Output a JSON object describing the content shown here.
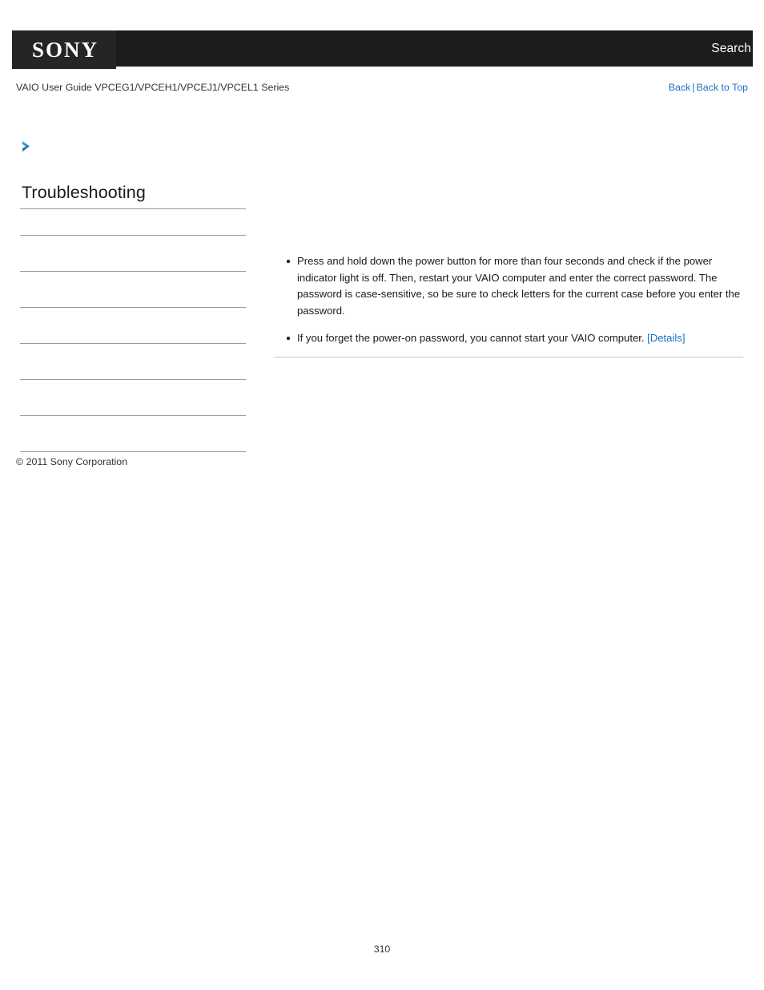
{
  "header": {
    "logo_text": "SONY",
    "search_label": "Search",
    "logo_bg": "#252525",
    "bar_bg": "#1c1c1c"
  },
  "subheader": {
    "guide_title": "VAIO User Guide VPCEG1/VPCEH1/VPCEJ1/VPCEL1 Series",
    "back_label": "Back",
    "separator": "|",
    "back_to_top_label": "Back to Top",
    "link_color": "#1d6fc4"
  },
  "breadcrumb": {
    "icon": "chevron-right-icon",
    "icon_color": "#1d7fc9"
  },
  "left_column": {
    "heading": "Troubleshooting",
    "menu_items": [
      {
        "label": ""
      },
      {
        "label": ""
      },
      {
        "label": ""
      },
      {
        "label": ""
      },
      {
        "label": ""
      },
      {
        "label": ""
      },
      {
        "label": ""
      }
    ],
    "copyright": "© 2011 Sony Corporation"
  },
  "main": {
    "bullets": [
      {
        "text": "Press and hold down the power button for more than four seconds and check if the power indicator light is off. Then, restart your VAIO computer and enter the correct password. The password is case-sensitive, so be sure to check letters for the current case before you enter the password.",
        "link": ""
      },
      {
        "text": "If you forget the power-on password, you cannot start your VAIO computer. ",
        "link": "[Details]"
      }
    ]
  },
  "footer": {
    "page_number": "310"
  }
}
